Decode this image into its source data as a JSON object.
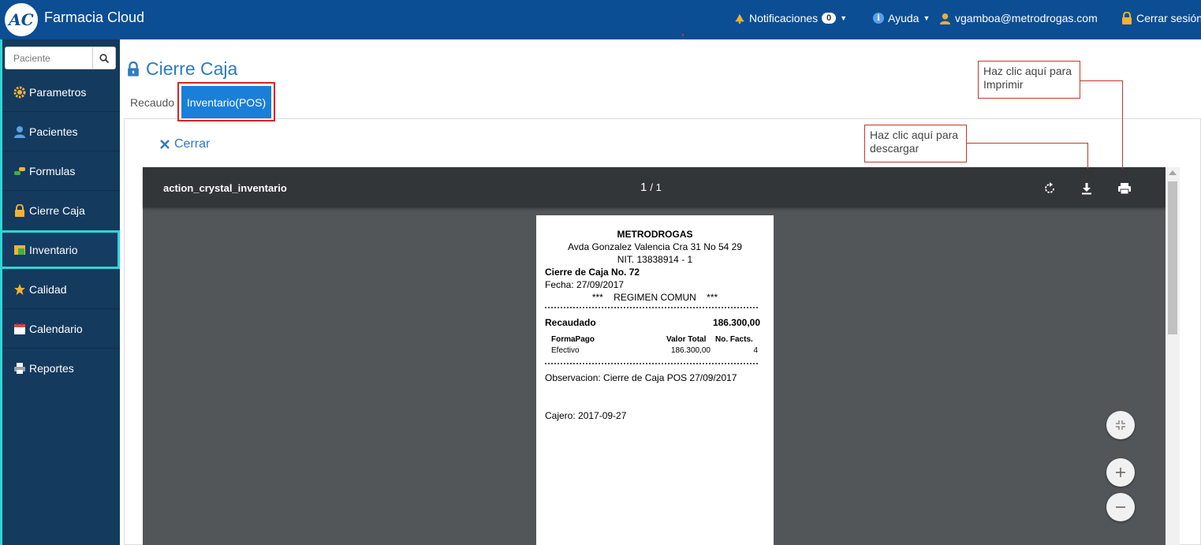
{
  "app": {
    "logo_text": "AC",
    "title": "Farmacia Cloud"
  },
  "topnav": {
    "notifications_label": "Notificaciones",
    "notifications_count": "0",
    "help_label": "Ayuda",
    "user_email": "vgamboa@metrodrogas.com",
    "logout_label": "Cerrar sesión"
  },
  "sidebar": {
    "search_placeholder": "Paciente",
    "items": [
      {
        "label": "Parametros",
        "icon": "gear-icon"
      },
      {
        "label": "Pacientes",
        "icon": "user-icon"
      },
      {
        "label": "Formulas",
        "icon": "pills-icon"
      },
      {
        "label": "Cierre Caja",
        "icon": "lock-icon"
      },
      {
        "label": "Inventario",
        "icon": "box-icon",
        "active": true
      },
      {
        "label": "Calidad",
        "icon": "star-icon"
      },
      {
        "label": "Calendario",
        "icon": "calendar-icon"
      },
      {
        "label": "Reportes",
        "icon": "printer-icon"
      }
    ]
  },
  "page": {
    "title": "Cierre Caja",
    "tabs": [
      {
        "label": "Recaudo"
      },
      {
        "label": "Inventario(POS)",
        "active": true
      }
    ],
    "close_label": "Cerrar"
  },
  "viewer": {
    "file_name": "action_crystal_inventario",
    "current_page": "1",
    "total_pages": "/ 1"
  },
  "receipt": {
    "company": "METRODROGAS",
    "address": "Avda Gonzalez Valencia Cra 31 No 54 29",
    "nit": "NIT. 13838914 - 1",
    "closing": "Cierre de Caja No. 72",
    "date": "Fecha: 27/09/2017",
    "regime": "***    REGIMEN COMUN    ***",
    "collected_label": "Recaudado",
    "collected_value": "186.300,00",
    "headers": {
      "payment": "FormaPago",
      "total": "Valor Total",
      "count": "No. Facts."
    },
    "rows": [
      {
        "payment": "Efectivo",
        "total": "186.300,00",
        "count": "4"
      }
    ],
    "observation": "Observacion: Cierre de Caja POS 27/09/2017",
    "cashier": "Cajero: 2017-09-27"
  },
  "callouts": {
    "print_line1": "Haz clic aquí para",
    "print_line2": "Imprimir",
    "download_line1": "Haz clic aquí para",
    "download_line2": "descargar"
  },
  "colors": {
    "topbar": "#0b4e94",
    "sidebar": "#143a5e",
    "sidebar_active_border": "#2ed6d6",
    "accent": "#2f7bbf",
    "tab_active": "#1a7fd8",
    "highlight_red": "#d22"
  }
}
